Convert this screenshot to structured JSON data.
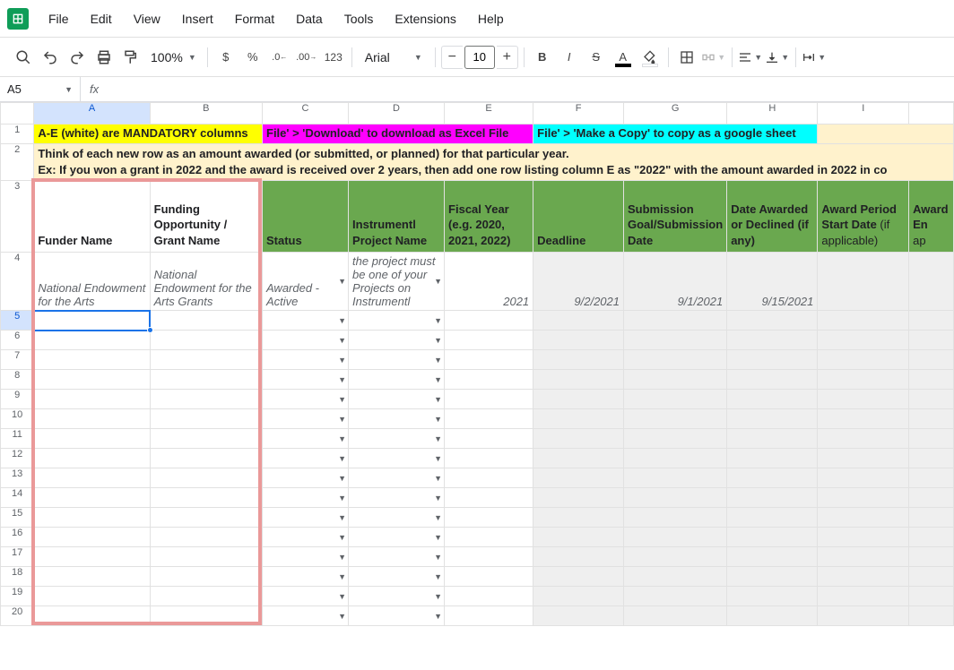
{
  "menu": {
    "items": [
      "File",
      "Edit",
      "View",
      "Insert",
      "Format",
      "Data",
      "Tools",
      "Extensions",
      "Help"
    ]
  },
  "toolbar": {
    "zoom": "100%",
    "currency": "$",
    "percent": "%",
    "decrease_dec": ".0",
    "increase_dec": ".00",
    "number_format": "123",
    "font": "Arial",
    "font_size": "10",
    "minus": "−",
    "plus": "+"
  },
  "namebox": "A5",
  "fx": "fx",
  "columns": [
    "A",
    "B",
    "C",
    "D",
    "E",
    "F",
    "G",
    "H",
    "I"
  ],
  "row_nums": [
    "1",
    "2",
    "3",
    "4",
    "5",
    "6",
    "7",
    "8",
    "9",
    "10",
    "11",
    "12",
    "13",
    "14",
    "15",
    "16",
    "17",
    "18",
    "19",
    "20"
  ],
  "banner": {
    "r1_yellow": "A-E (white) are MANDATORY columns",
    "r1_magenta": "File' > 'Download' to download as Excel File",
    "r1_cyan": "File' > 'Make a Copy' to copy as a google sheet",
    "r2_line1": "Think of each new row as an amount awarded (or submitted, or planned) for that particular year.",
    "r2_line2": "Ex: If you won a grant in 2022 and the award is received over 2 years, then add one row listing column E as \"2022\" with the amount awarded in 2022 in co"
  },
  "headers": {
    "A": "Funder Name",
    "B": "Funding Opportunity / Grant Name",
    "C": "Status",
    "D": "Instrumentl Project Name",
    "E": "Fiscal Year (e.g. 2020, 2021, 2022)",
    "F": "Deadline",
    "G": "Submission Goal/Submission Date",
    "H": "Date Awarded or Declined (if any)",
    "I_plain": "Award Period Start Date",
    "I_suffix": " (if applicable)",
    "J": "Award En"
  },
  "data_row": {
    "A": "National Endowment for the Arts",
    "B": "National Endowment for the Arts Grants",
    "C": "Awarded - Active",
    "D": "the project must be one of your Projects on Instrumentl",
    "E": "2021",
    "F": "9/2/2021",
    "G": "9/1/2021",
    "H": "9/15/2021"
  },
  "dropdown_arrow": "▼"
}
